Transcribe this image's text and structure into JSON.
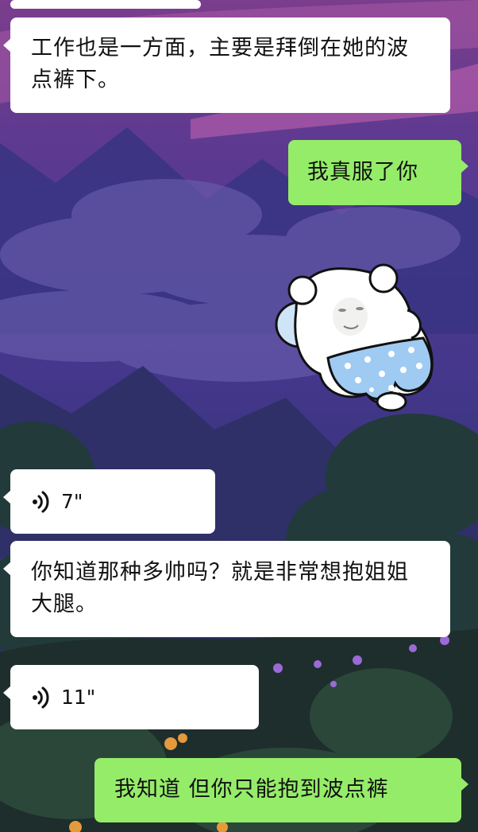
{
  "chat": {
    "messages": [
      {
        "kind": "text",
        "side": "in",
        "text": ""
      },
      {
        "kind": "text",
        "side": "in",
        "text": "工作也是一方面，主要是拜倒在她的波点裤下。"
      },
      {
        "kind": "text",
        "side": "out",
        "text": "我真服了你"
      },
      {
        "kind": "sticker",
        "side": "out",
        "sticker": "polar-bear-polka-dot-shorts"
      },
      {
        "kind": "voice",
        "side": "in",
        "duration": "7\""
      },
      {
        "kind": "text",
        "side": "in",
        "text": "你知道那种多帅吗？就是非常想抱姐姐大腿。"
      },
      {
        "kind": "voice",
        "side": "in",
        "duration": "11\""
      },
      {
        "kind": "text",
        "side": "out",
        "text": "我知道 但你只能抱到波点裤"
      }
    ]
  },
  "colors": {
    "incoming_bubble": "#ffffff",
    "outgoing_bubble": "#95ec69",
    "sky_top": "#7a3f92",
    "sky_mid": "#4a3a8f",
    "ground": "#1d2b2a"
  },
  "icons": {
    "voice": "voice-wave-icon"
  }
}
